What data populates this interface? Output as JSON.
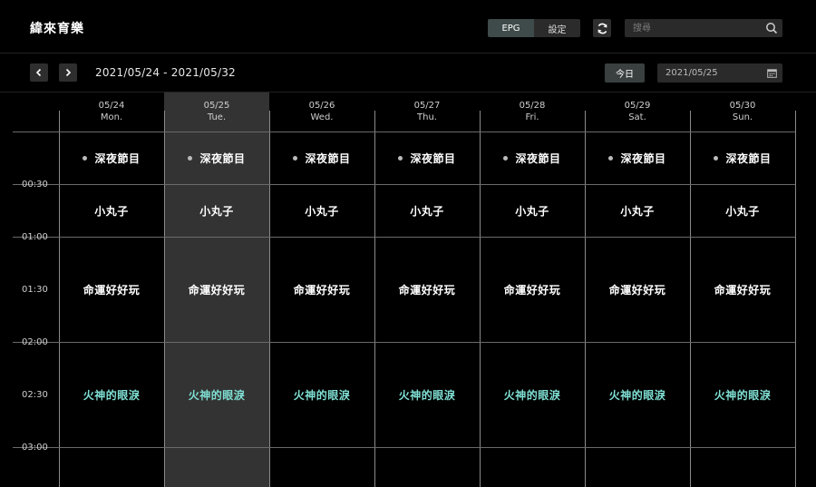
{
  "header": {
    "title": "緯來育樂",
    "modes": [
      {
        "label": "EPG",
        "active": true
      },
      {
        "label": "設定",
        "active": false
      }
    ],
    "search": {
      "placeholder": "搜尋",
      "value": ""
    }
  },
  "nav": {
    "range": "2021/05/24 - 2021/05/32",
    "today_label": "今日",
    "date_value": "2021/05/25"
  },
  "days": [
    {
      "date": "05/24",
      "dow": "Mon."
    },
    {
      "date": "05/25",
      "dow": "Tue."
    },
    {
      "date": "05/26",
      "dow": "Wed."
    },
    {
      "date": "05/27",
      "dow": "Thu."
    },
    {
      "date": "05/28",
      "dow": "Fri."
    },
    {
      "date": "05/29",
      "dow": "Sat."
    },
    {
      "date": "05/30",
      "dow": "Sun."
    }
  ],
  "times": [
    "00:30",
    "01:00",
    "01:30",
    "02:00",
    "02:30",
    "03:00"
  ],
  "programs": [
    {
      "title": "深夜節目",
      "dot": true,
      "color": "#ffffff"
    },
    {
      "title": "小丸子",
      "dot": false,
      "color": "#ffffff"
    },
    {
      "title": "命運好好玩",
      "dot": false,
      "color": "#ffffff"
    },
    {
      "title": "火神的眼淚",
      "dot": false,
      "color": "#7fe0d4"
    }
  ],
  "colors": {
    "today_column": "#333333",
    "accent_teal": "#7fe0d4"
  },
  "icons": [
    "refresh-icon",
    "search-icon",
    "chevron-left-icon",
    "chevron-right-icon",
    "calendar-icon"
  ]
}
